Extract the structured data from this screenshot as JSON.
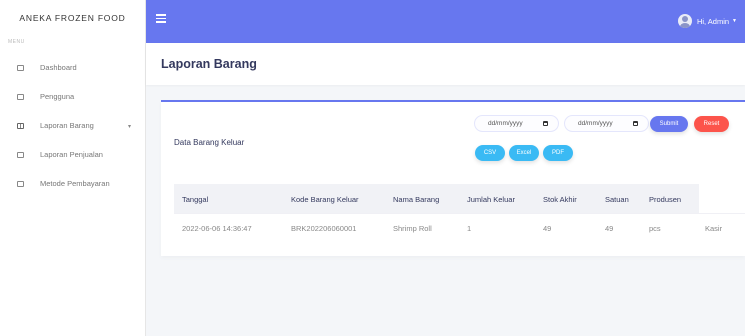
{
  "sidebar": {
    "brand": "ANEKA FROZEN FOOD",
    "menu_label": "MENU",
    "items": [
      {
        "label": "Dashboard"
      },
      {
        "label": "Pengguna"
      },
      {
        "label": "Laporan Barang"
      },
      {
        "label": "Laporan Penjualan"
      },
      {
        "label": "Metode Pembayaran"
      }
    ]
  },
  "topbar": {
    "user_greeting": "Hi, Admin"
  },
  "header": {
    "title": "Laporan Barang"
  },
  "card": {
    "title": "Data Barang Keluar",
    "date_from": "dd/mm/yyyy",
    "date_to": "dd/mm/yyyy",
    "submit_label": "Submit",
    "reset_label": "Reset",
    "export_buttons": [
      "CSV",
      "Excel",
      "PDF"
    ],
    "colors": {
      "primary": "#6777ef",
      "danger": "#fc544b",
      "info": "#3abaf4"
    }
  },
  "table": {
    "columns": [
      "Tanggal",
      "Kode Barang Keluar",
      "Nama Barang",
      "Jumlah Keluar",
      "Stok Akhir",
      "Satuan",
      "Produsen"
    ],
    "rows": [
      [
        "2022-06-06 14:36:47",
        "BRK202206060001",
        "Shrimp Roll",
        "1",
        "49",
        "49",
        "pcs",
        "Kasir"
      ]
    ]
  }
}
